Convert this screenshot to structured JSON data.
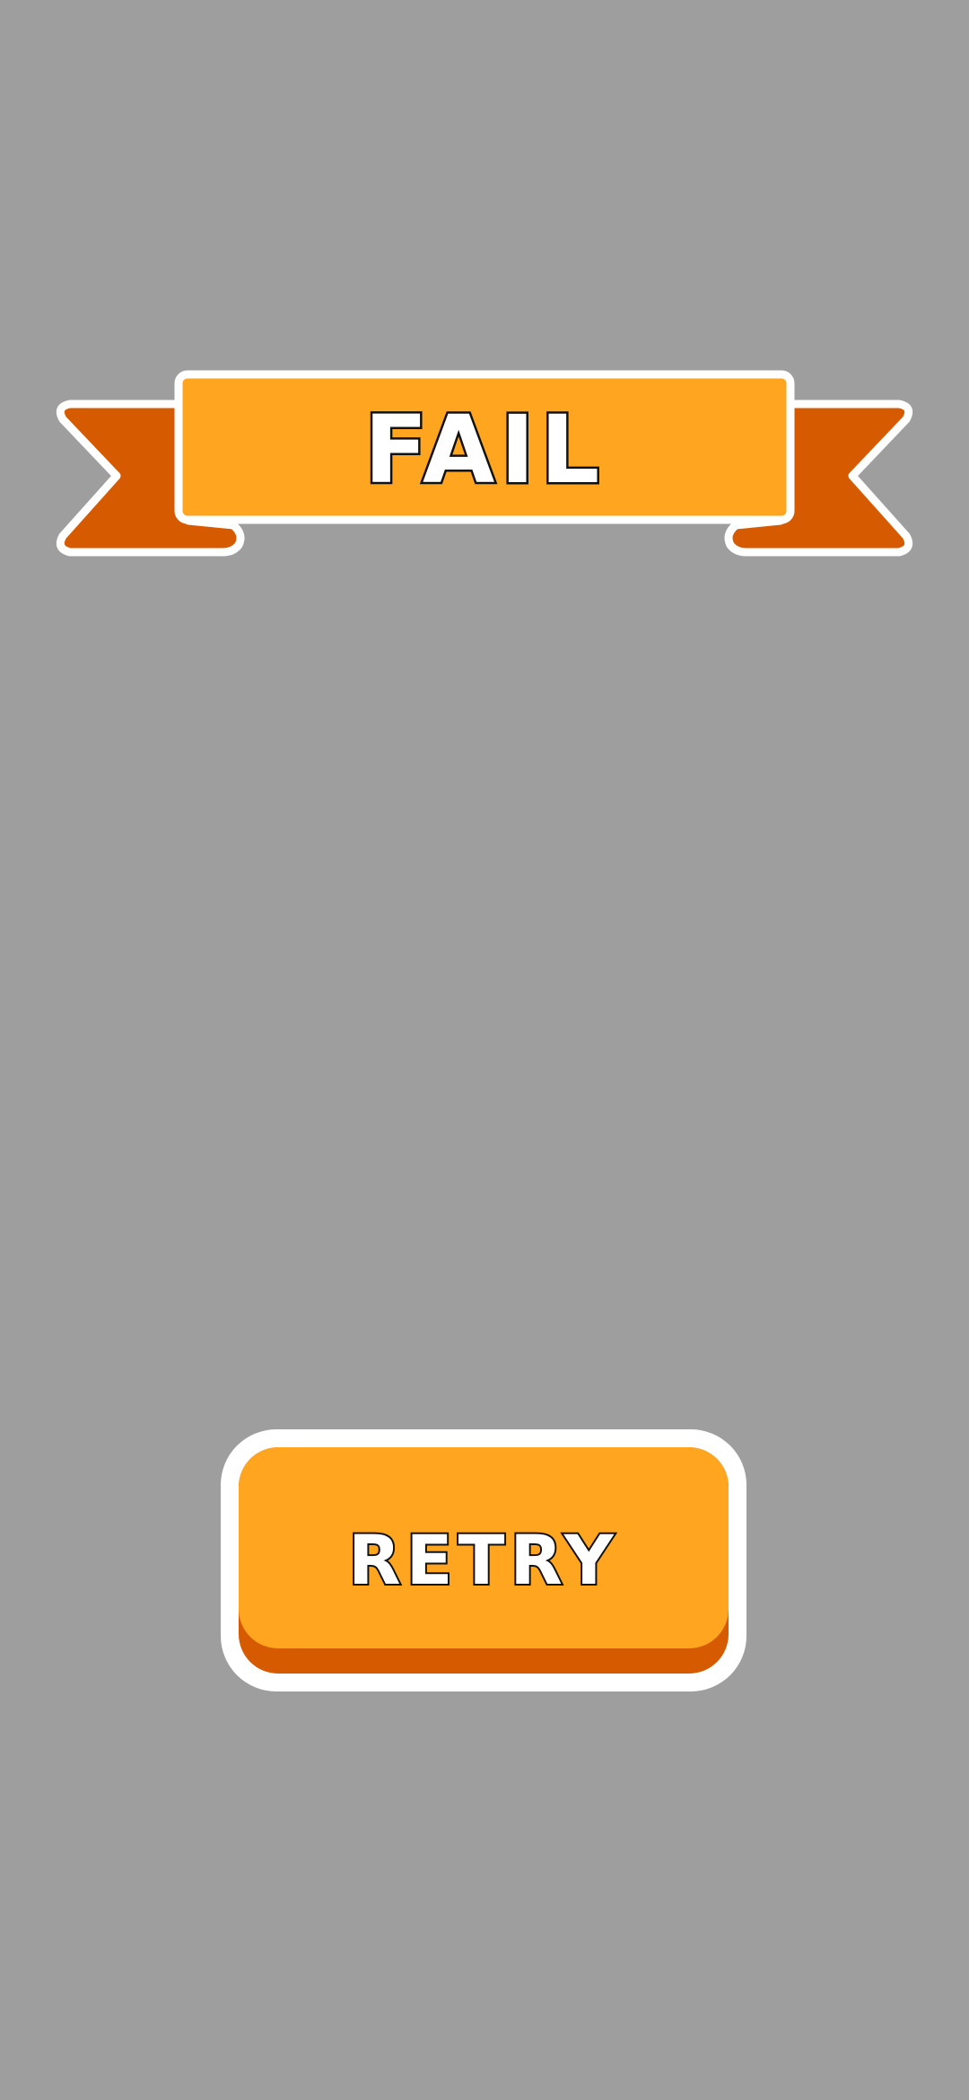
{
  "banner": {
    "title": "FAIL"
  },
  "actions": {
    "retry_label": "RETRY"
  },
  "colors": {
    "background": "#9e9e9e",
    "banner_main": "#ffa51f",
    "banner_tail": "#d65a00",
    "outline": "#ffffff",
    "text_stroke": "#111111"
  }
}
